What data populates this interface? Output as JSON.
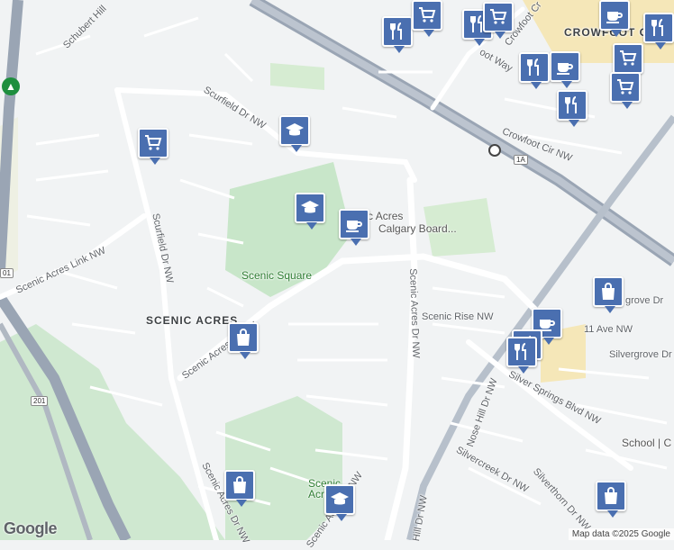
{
  "map": {
    "labels": {
      "schubert_hill": "Schubert Hill",
      "scurfield_dr_nw_top": "Scurfield Dr NW",
      "scurfield_dr_nw_left": "Scurfield Dr NW",
      "scenic_acres_link": "Scenic Acres Link NW",
      "scenic_acres_area": "SCENIC ACRES",
      "scenic_acres_dr_left": "Scenic Acres Dr NW",
      "scenic_square": "Scenic Square",
      "scenic_acres_school": "Scenic Acres",
      "calgary_board": "Calgary Board...",
      "scenic_acres_dr_right": "Scenic Acres Dr NW",
      "scenic_rise": "Scenic Rise NW",
      "nose_hill_dr": "Nose Hill Dr NW",
      "silver_springs_blvd": "Silver Springs Blvd NW",
      "silvercreek": "Silvercreek Dr NW",
      "silverthorn": "Silverthorn Dr NW",
      "silvergrove_dr": "Silvergrove Dr",
      "silvergrove_top": "grove Dr",
      "eleven_ave": "11 Ave NW",
      "crowfoot_cir": "Crowfoot Cir NW",
      "crowfoot_way": "oot Way",
      "crowfoot_cres": "Crowfoot Cr",
      "crowfoot_crossing": "CROWFOOT CROSSI",
      "school_right": "School | C",
      "scenic_acres_park": "Scenic Acres P",
      "scenic_acres_dr_bottom": "Scenic Acres Dr NW",
      "hill_dr_bottom": "Hill Dr NW",
      "highway_1a": "1A",
      "highway_201": "201",
      "highway_201_top": "01"
    },
    "pins": [
      {
        "type": "shopping-cart",
        "x": 0
      },
      {
        "type": "school"
      },
      {
        "type": "school"
      },
      {
        "type": "cafe"
      },
      {
        "type": "shopping-bag"
      },
      {
        "type": "shopping-bag"
      },
      {
        "type": "shopping-bag"
      },
      {
        "type": "shopping-bag"
      },
      {
        "type": "school"
      },
      {
        "type": "restaurant"
      },
      {
        "type": "shopping-cart"
      },
      {
        "type": "restaurant"
      },
      {
        "type": "shopping-cart"
      },
      {
        "type": "cafe"
      },
      {
        "type": "restaurant"
      },
      {
        "type": "cafe"
      },
      {
        "type": "shopping-cart"
      },
      {
        "type": "shopping-cart"
      },
      {
        "type": "restaurant"
      },
      {
        "type": "cafe"
      },
      {
        "type": "restaurant"
      },
      {
        "type": "cafe"
      },
      {
        "type": "restaurant"
      }
    ]
  },
  "branding": {
    "logo": "Google",
    "attribution": "Map data ©2025 Google"
  },
  "colors": {
    "pin": "#4a6fb0",
    "park": "#c8e6c9",
    "highway": "#9aa5b4",
    "road": "#ffffff",
    "commercial": "#f5e7b8"
  }
}
